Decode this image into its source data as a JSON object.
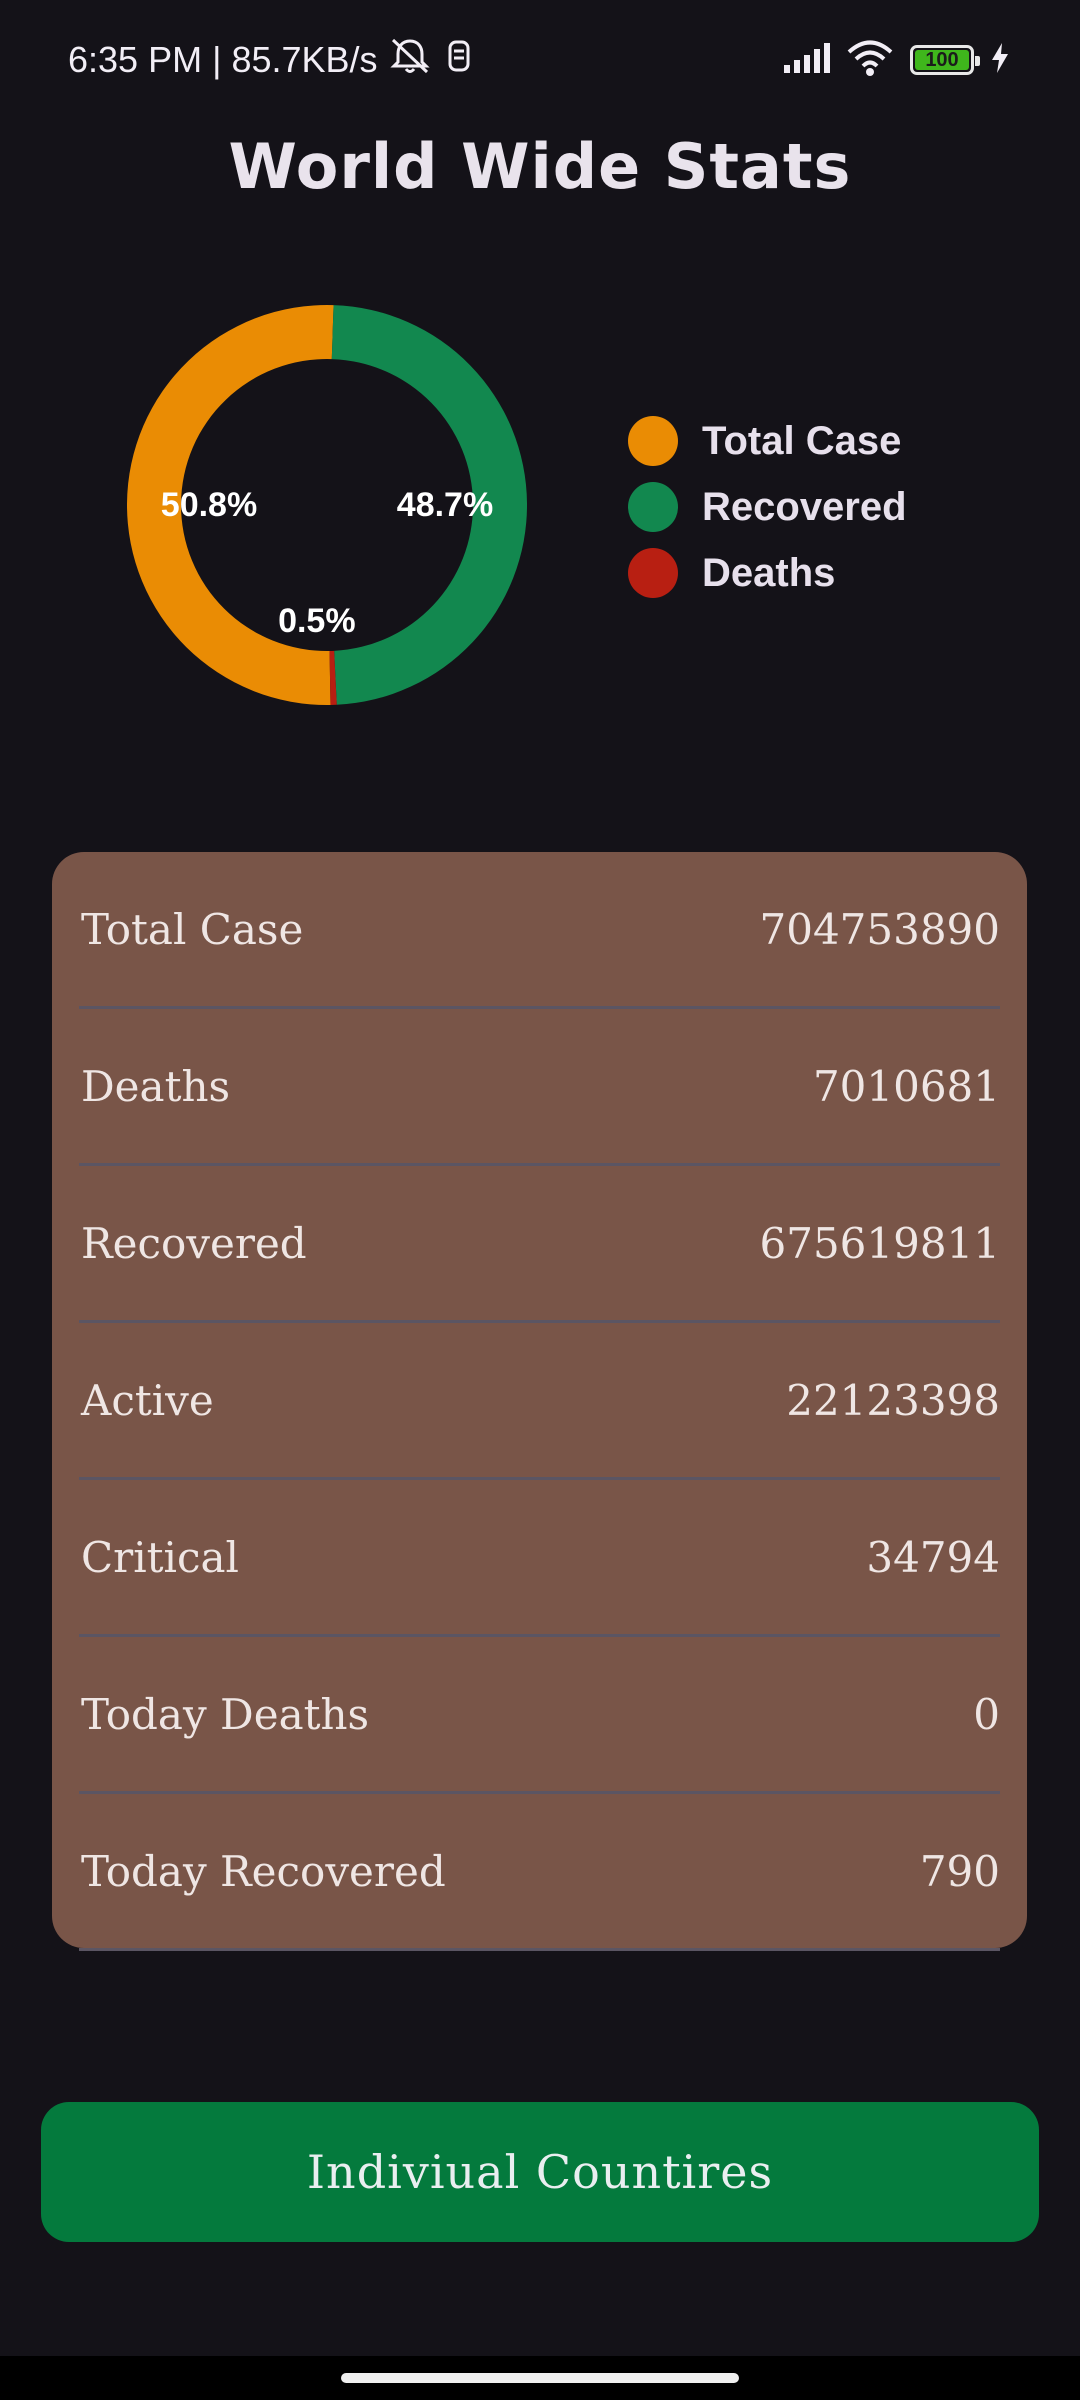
{
  "status_bar": {
    "time": "6:35 PM",
    "separator": "|",
    "net_speed": "85.7KB/s",
    "battery": "100",
    "icons": [
      "bell-off-icon",
      "sim-icon",
      "signal-icon",
      "wifi-icon",
      "battery-icon",
      "charging-icon"
    ]
  },
  "header": {
    "title": "World Wide Stats"
  },
  "chart_data": {
    "type": "pie",
    "donut": true,
    "categories": [
      "Total Case",
      "Recovered",
      "Deaths"
    ],
    "values": [
      50.8,
      48.7,
      0.5
    ],
    "colors": [
      "#ea8c04",
      "#12884f",
      "#b81f12"
    ],
    "labels": [
      "50.8%",
      "48.7%",
      "0.5%"
    ],
    "legend_position": "right"
  },
  "legend": [
    {
      "label": "Total Case",
      "color": "#ea8c04"
    },
    {
      "label": "Recovered",
      "color": "#12884f"
    },
    {
      "label": "Deaths",
      "color": "#b81f12"
    }
  ],
  "stats": {
    "rows": [
      {
        "label": "Total Case",
        "value": "704753890"
      },
      {
        "label": "Deaths",
        "value": "7010681"
      },
      {
        "label": "Recovered",
        "value": "675619811"
      },
      {
        "label": "Active",
        "value": "22123398"
      },
      {
        "label": "Critical",
        "value": "34794"
      },
      {
        "label": "Today Deaths",
        "value": "0"
      },
      {
        "label": "Today Recovered",
        "value": "790"
      }
    ]
  },
  "actions": {
    "countries_button": "Indiviual Countires"
  },
  "colors": {
    "background": "#141218",
    "card": "#795548",
    "button": "#047a3d"
  }
}
